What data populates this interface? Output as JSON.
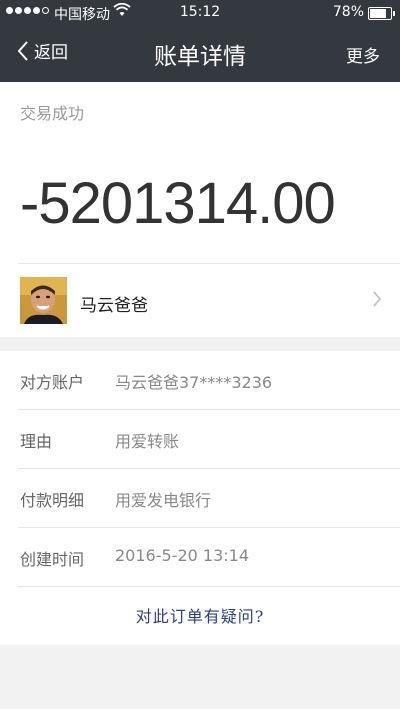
{
  "status_bar": {
    "carrier": "中国移动",
    "time": "15:12",
    "battery": "78%",
    "battery_level": 0.78,
    "signal_bars": 4
  },
  "nav": {
    "back_label": "返回",
    "title": "账单详情",
    "more_label": "更多"
  },
  "transaction": {
    "status": "交易成功",
    "amount": "-5201314.00",
    "payee_name": "马云爸爸"
  },
  "details": [
    {
      "label": "对方账户",
      "value": "马云爸爸37****3236"
    },
    {
      "label": "理由",
      "value": "用爱转账"
    },
    {
      "label": "付款明细",
      "value": "用爱发电银行"
    },
    {
      "label": "创建时间",
      "value": "2016-5-20  13:14"
    }
  ],
  "footer": {
    "question_link": "对此订单有疑问?"
  },
  "colors": {
    "header_bg": "#34393f",
    "link": "#2a3f8a"
  }
}
